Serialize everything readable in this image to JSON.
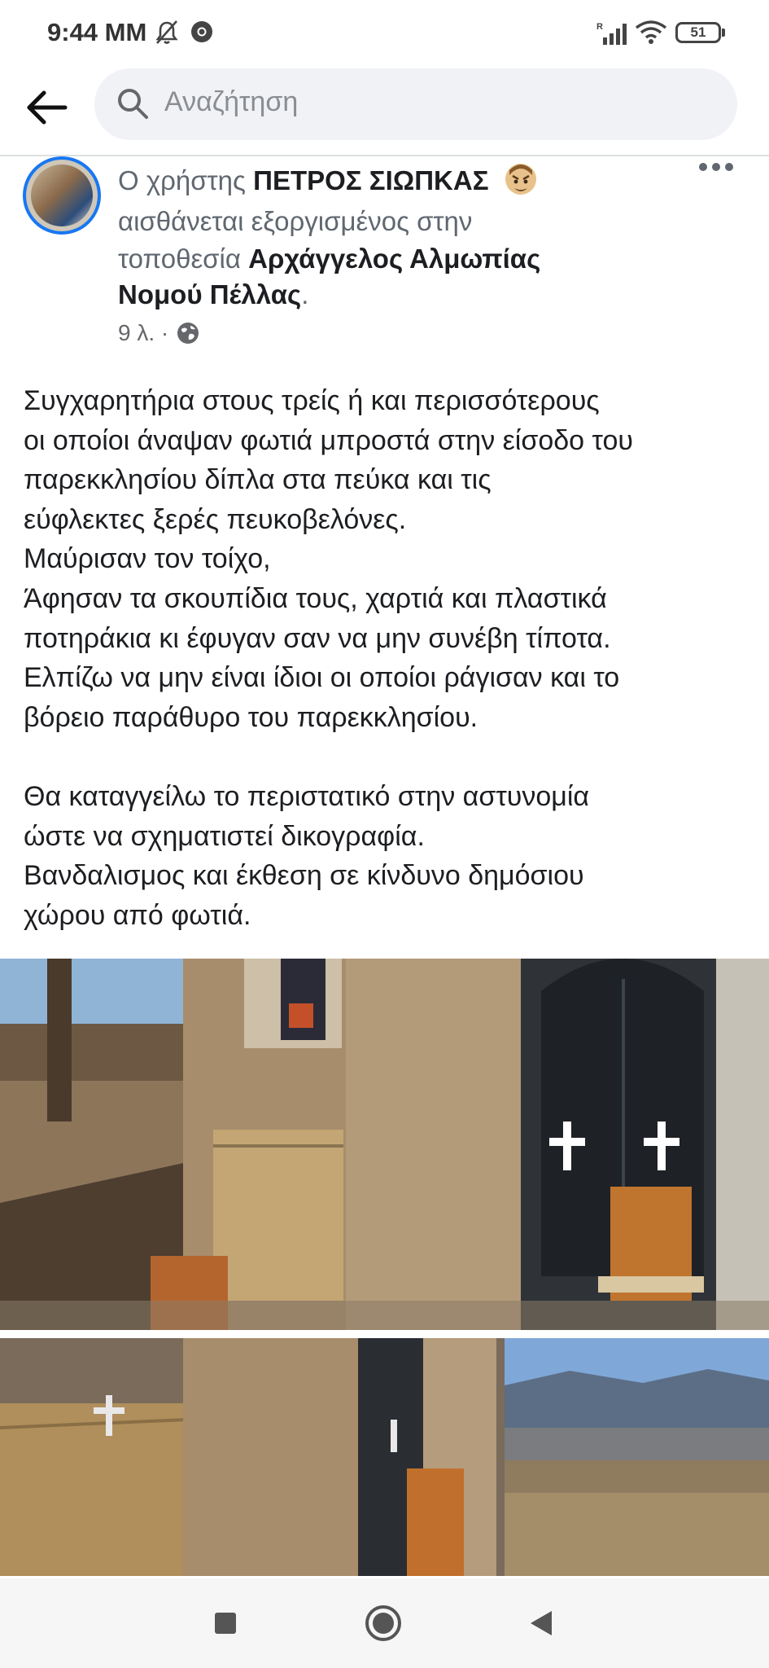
{
  "status_bar": {
    "time": "9:44 MM",
    "battery": "51"
  },
  "header": {
    "search_placeholder": "Αναζήτηση"
  },
  "post": {
    "line1_prefix": "Ο χρήστης",
    "author": "ΠΕΤΡΟΣ ΣΙΩΠΚΑΣ",
    "line2": "αισθάνεται εξοργισμένος στην",
    "line3_prefix": "τοποθεσία",
    "location_part1": "Αρχάγγελος Αλμωπίας",
    "location_part2": "Νομού Πέλλας",
    "location_suffix": ".",
    "time_ago": "9 λ. ·",
    "body_lines": [
      "Συγχαρητήρια στους τρείς ή και περισσότερους",
      "οι οποίοι άναψαν φωτιά μπροστά στην είσοδο του",
      "παρεκκλησίου δίπλα στα πεύκα και τις",
      "εύφλεκτες ξερές πευκοβελόνες.",
      "Μαύρισαν τον τοίχο,",
      "Άφησαν  τα σκουπίδια τους, χαρτιά και πλαστικά",
      "ποτηράκια κι έφυγαν σαν να μην συνέβη τίποτα.",
      "Ελπίζω να μην είναι ίδιοι οι οποίοι ράγισαν και  το",
      "βόρειο παράθυρο του παρεκκλησίου.",
      "",
      "Θα καταγγείλω το περιστατικό στην αστυνομία",
      "ώστε να σχηματιστεί δικογραφία.",
      "Βανδαλισμος και έκθεση σε κίνδυνο δημόσιου",
      "χώρου από φωτιά."
    ]
  },
  "colors": {
    "accent": "#1877f2",
    "text": "#1c1e21",
    "secondary": "#606770"
  },
  "icons": {
    "back": "arrow-left-icon",
    "search": "search-icon",
    "more": "more-horizontal-icon",
    "privacy": "globe-icon",
    "feeling": "angry-face-icon"
  }
}
